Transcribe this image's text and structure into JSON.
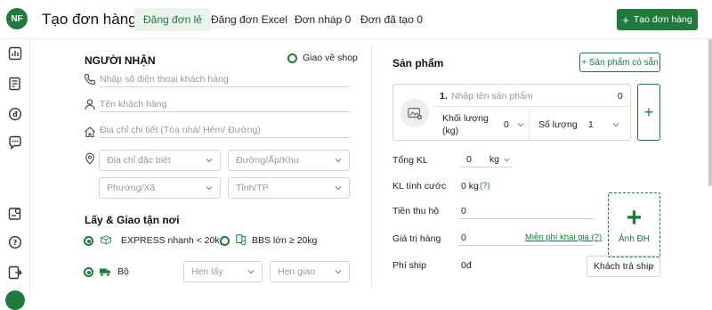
{
  "header": {
    "avatar_initials": "NF",
    "title": "Tạo đơn hàng",
    "tabs": [
      "Đăng đơn lẻ",
      "Đăng đơn Excel",
      "Đơn nháp 0",
      "Đơn đã tạo 0"
    ],
    "active_tab": "Đăng đơn lẻ",
    "create_button": "Tạo đơn hàng"
  },
  "sidebar": {
    "icons": [
      "chart-icon",
      "document-edit-icon",
      "coin-icon",
      "chat-icon",
      "box-search-icon",
      "help-icon",
      "export-icon"
    ]
  },
  "receiver": {
    "title": "NGƯỜI NHẬN",
    "ship_to_shop_label": "Giao về shop",
    "phone_placeholder": "Nhập số điện thoại khách hàng",
    "name_placeholder": "Tên khách hàng",
    "address_placeholder": "Địa chỉ chi tiết (Tòa nhà/ Hẻm/ Đường)",
    "special_address_placeholder": "Địa chỉ đặc biệt",
    "street_placeholder": "Đường/Ấp/Khu",
    "ward_placeholder": "Phường/Xã",
    "province_placeholder": "Tỉnh/TP"
  },
  "pickup": {
    "title": "Lấy & Giao tận nơi",
    "express_label": "EXPRESS nhanh < 20kg",
    "bbs_label": "BBS lớn ≥ 20kg",
    "road_label": "Bộ",
    "pickup_time_placeholder": "Hẹn lấy",
    "delivery_time_placeholder": "Hẹn giao"
  },
  "product": {
    "title": "Sản phẩm",
    "available_button": "+ Sản phẩm có sẵn",
    "row_index": "1.",
    "name_placeholder": "Nhập tên sản phẩm",
    "amount": "0",
    "weight_label": "Khối lượng (kg)",
    "weight_value": "0",
    "quantity_label": "Số lượng",
    "quantity_value": "1",
    "add_plus": "+"
  },
  "summary": {
    "total_weight_label": "Tổng KL",
    "total_weight_value": "0",
    "total_weight_unit": "kg",
    "charged_weight_label": "KL tính cước",
    "charged_weight_value": "0 kg",
    "charged_weight_help": "(?)",
    "cod_label": "Tiền thu hộ",
    "cod_value": "0",
    "goods_value_label": "Giá trị hàng",
    "goods_value": "0",
    "free_declare_link": "Miễn phí khai giá (?)",
    "ship_fee_label": "Phí ship",
    "ship_fee_value": "0đ",
    "payer_select": "Khách trả ship",
    "photo_label": "Ảnh ĐH",
    "photo_plus": "+"
  },
  "colors": {
    "brand_green": "#1f7a3c",
    "tab_active_bg": "#e9f3ec"
  }
}
